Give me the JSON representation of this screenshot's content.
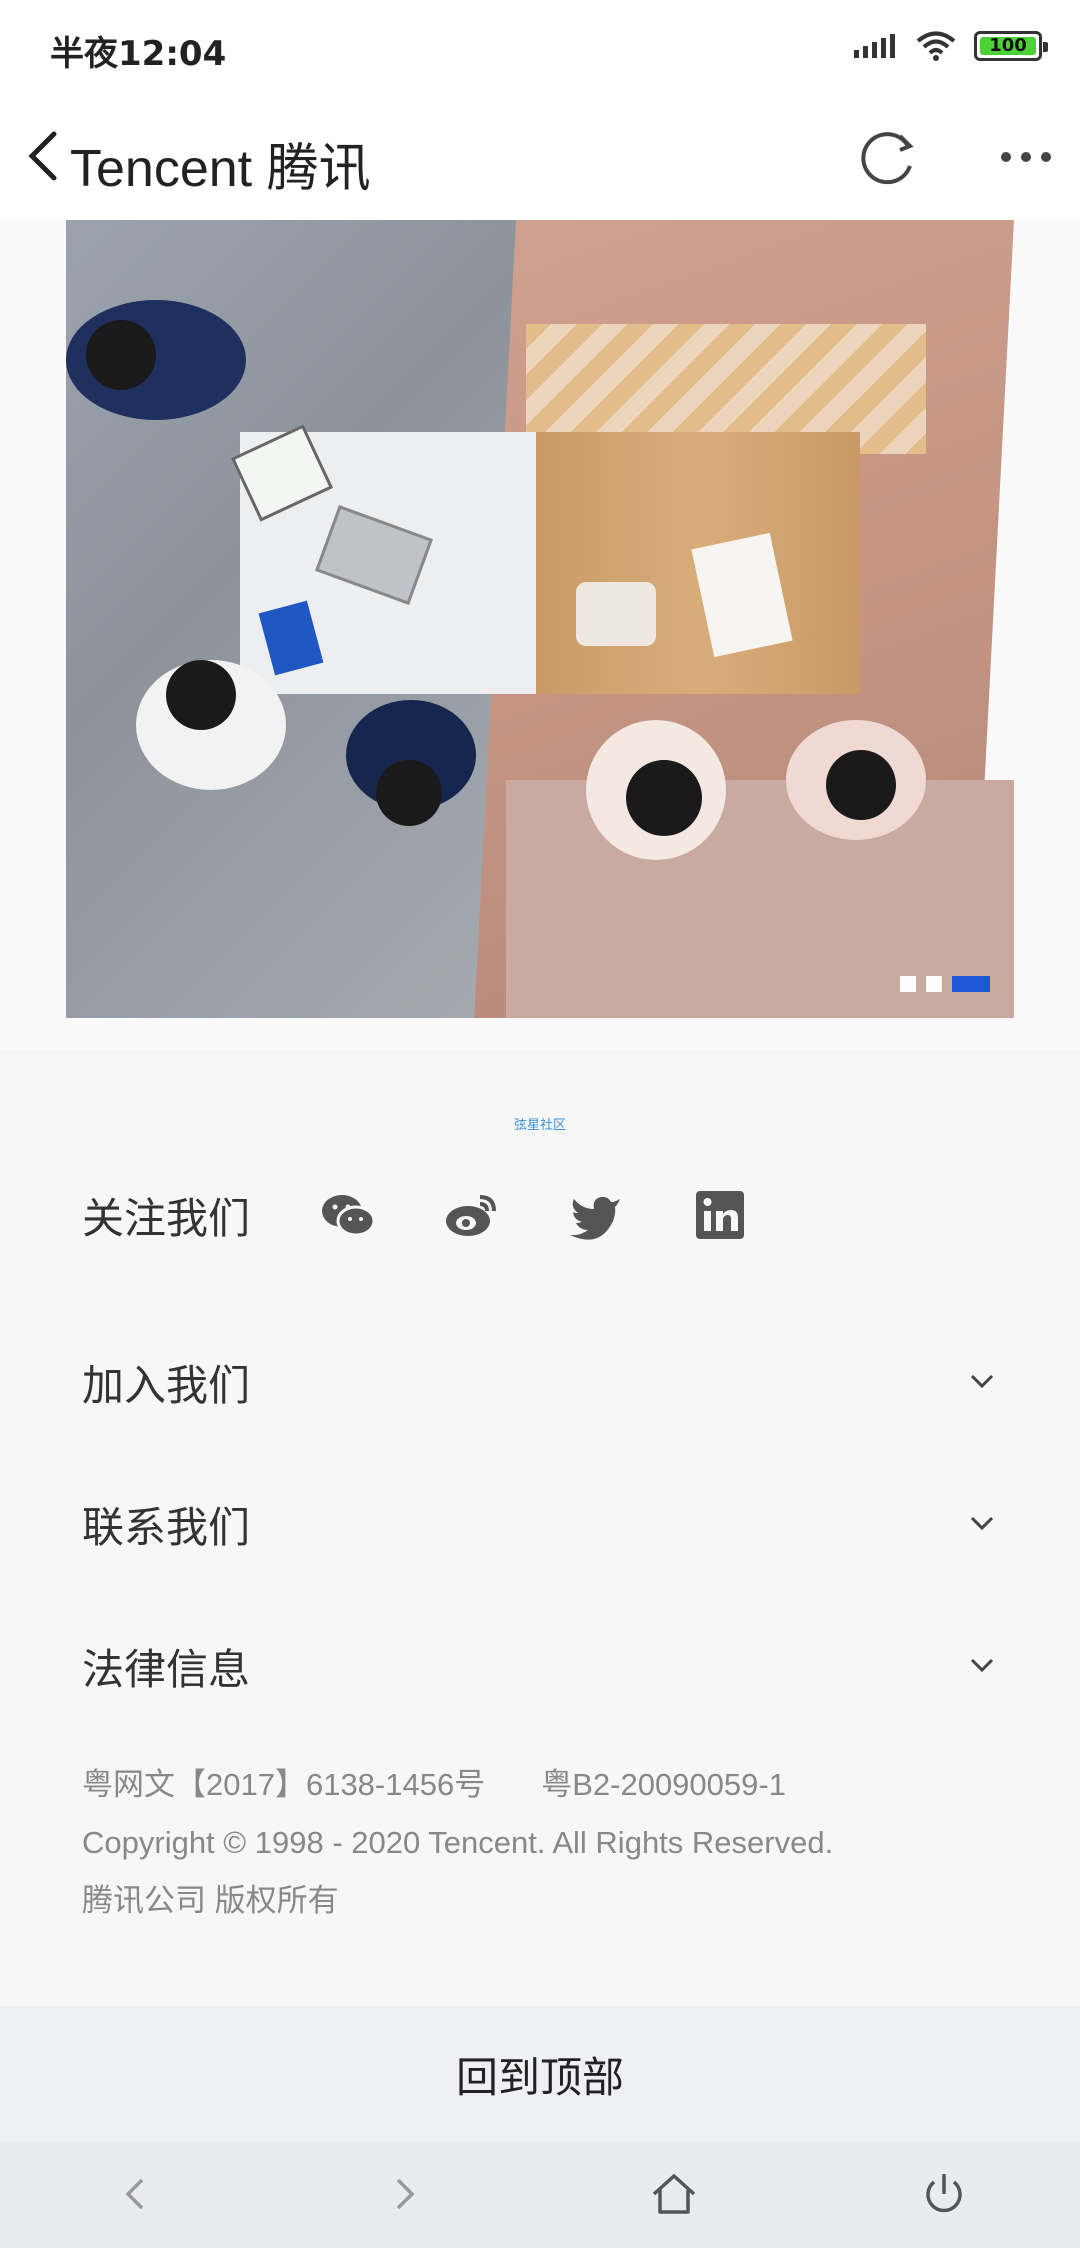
{
  "status_bar": {
    "time": "半夜12:04",
    "battery": "100"
  },
  "nav": {
    "title": "Tencent 腾讯"
  },
  "banner": {
    "slide_count": 3,
    "active_index": 2,
    "colors": {
      "active_dot": "#1e57d6"
    }
  },
  "watermark": "弦星社区",
  "follow": {
    "label": "关注我们",
    "icons": [
      "wechat-icon",
      "weibo-icon",
      "twitter-icon",
      "linkedin-icon"
    ]
  },
  "accordion": [
    {
      "label": "加入我们"
    },
    {
      "label": "联系我们"
    },
    {
      "label": "法律信息"
    }
  ],
  "legal": {
    "license_1": "粤网文【2017】6138-1456号",
    "license_2": "粤B2-20090059-1",
    "copyright": "Copyright © 1998 - 2020 Tencent. All Rights Reserved.",
    "rights": "腾讯公司 版权所有"
  },
  "back_to_top": "回到顶部"
}
